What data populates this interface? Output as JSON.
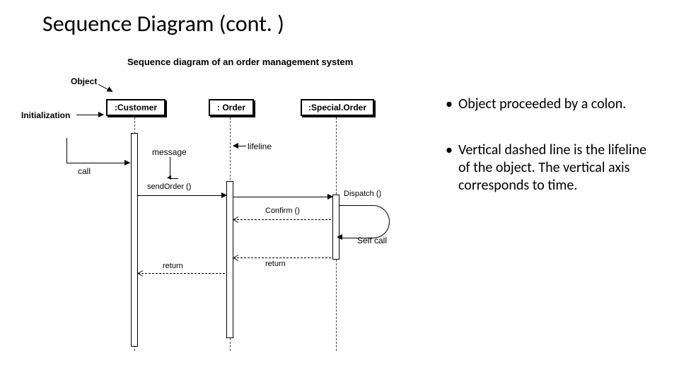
{
  "title": "Sequence Diagram (cont. )",
  "diagram": {
    "heading": "Sequence diagram of an order management system",
    "annot": {
      "object": "Object",
      "initialization": "Initialization",
      "call": "call",
      "message": "message",
      "lifeline": "lifeline",
      "self_call": "Self call"
    },
    "objects": {
      "customer": ":Customer",
      "order": ": Order",
      "special_order": ":Special.Order"
    },
    "messages": {
      "send_order": "sendOrder ()",
      "dispatch": "Dispatch ()",
      "confirm": "Confirm ()",
      "return1": "return",
      "return2": "return"
    }
  },
  "notes": {
    "bullet1": "Object proceeded by a colon.",
    "bullet2": "Vertical dashed line is the lifeline of the object. The vertical axis corresponds to time."
  }
}
